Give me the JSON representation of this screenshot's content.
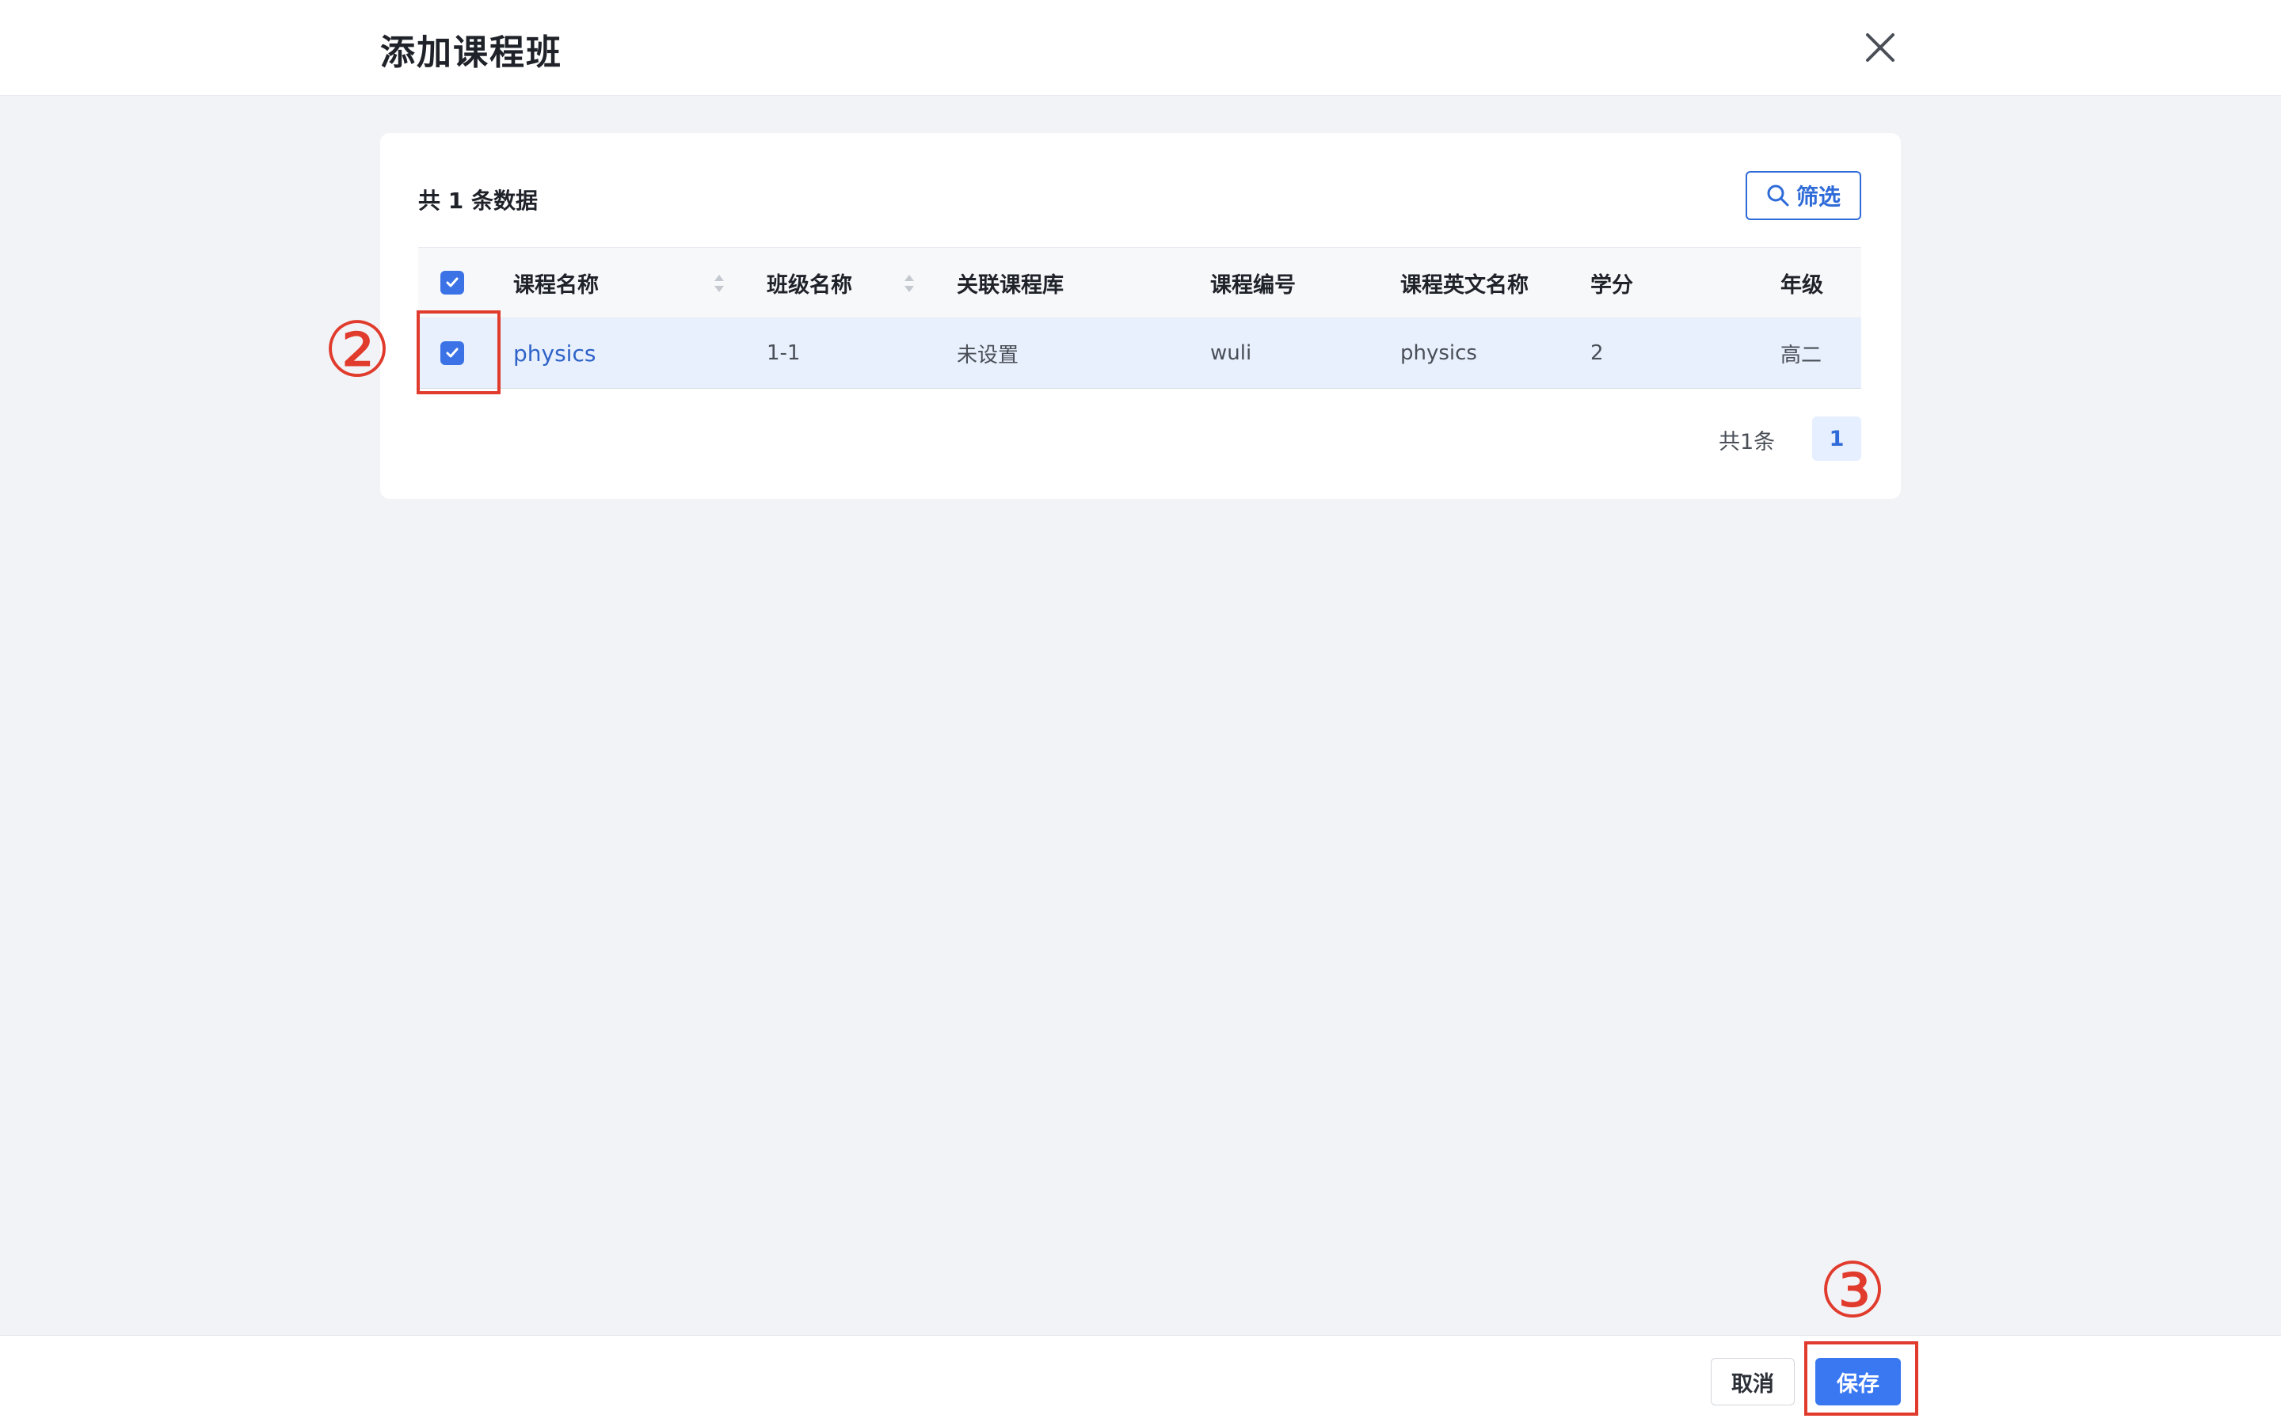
{
  "dialog": {
    "title": "添加课程班"
  },
  "toolbar": {
    "count_label": "共 1 条数据",
    "filter_label": "筛选"
  },
  "table": {
    "columns": [
      "课程名称",
      "班级名称",
      "关联课程库",
      "课程编号",
      "课程英文名称",
      "学分",
      "年级"
    ],
    "rows": [
      {
        "course_name": "physics",
        "class_name": "1-1",
        "course_library": "未设置",
        "course_code": "wuli",
        "english_name": "physics",
        "credit": "2",
        "grade": "高二",
        "selected": true
      }
    ]
  },
  "pagination": {
    "total_label": "共1条",
    "current_page": "1"
  },
  "annotations": {
    "step2": "②",
    "step3": "③"
  },
  "footer": {
    "cancel_label": "取消",
    "save_label": "保存"
  },
  "colors": {
    "accent": "#3a78f2",
    "annotation": "#e03b2c",
    "row_selected": "#e8f0fd"
  }
}
